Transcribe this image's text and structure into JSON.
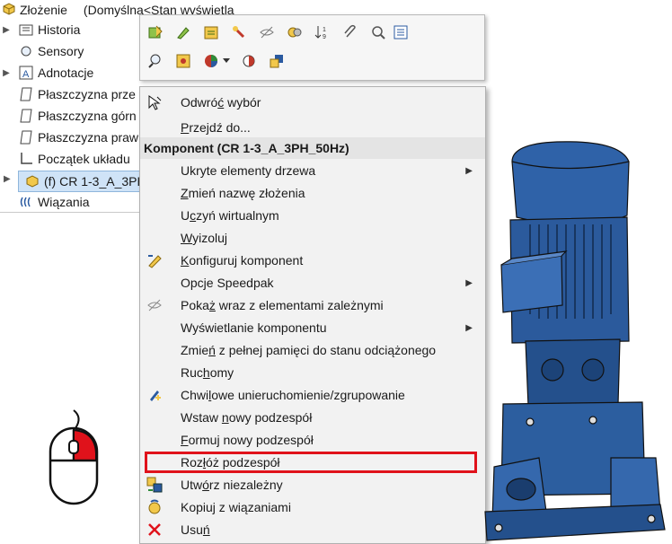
{
  "tree": {
    "title": "Złożenie",
    "config": "(Domyślna<Stan wyświetla",
    "items": [
      {
        "label": "Historia",
        "icon": "folder-icon",
        "expand": true
      },
      {
        "label": "Sensory",
        "icon": "sensor-icon",
        "expand": false
      },
      {
        "label": "Adnotacje",
        "icon": "annotation-icon",
        "expand": true
      },
      {
        "label": "Płaszczyzna prze",
        "icon": "plane-icon",
        "expand": false
      },
      {
        "label": "Płaszczyzna górn",
        "icon": "plane-icon",
        "expand": false
      },
      {
        "label": "Płaszczyzna praw",
        "icon": "plane-icon",
        "expand": false
      },
      {
        "label": "Początek układu",
        "icon": "origin-icon",
        "expand": false
      },
      {
        "label": "(f) CR 1-3_A_3PH",
        "icon": "subassembly-icon",
        "expand": true,
        "selected": true
      },
      {
        "label": "Wiązania",
        "icon": "mates-icon",
        "expand": false
      }
    ]
  },
  "menu": {
    "items": [
      {
        "pre": "Odwró",
        "u": "ć",
        "post": " wybór",
        "icon": "cursor-select-icon"
      },
      {
        "pre": "",
        "u": "P",
        "post": "rzejdź do...",
        "icon": ""
      },
      {
        "header": "Komponent (CR 1-3_A_3PH_50Hz)"
      },
      {
        "pre": "Ukryte elementy drzewa",
        "u": "",
        "post": "",
        "submenu": true
      },
      {
        "pre": "",
        "u": "Z",
        "post": "mień nazwę złożenia"
      },
      {
        "pre": "U",
        "u": "c",
        "post": "zyń wirtualnym"
      },
      {
        "pre": "",
        "u": "W",
        "post": "yizoluj"
      },
      {
        "pre": "",
        "u": "K",
        "post": "onfiguruj komponent",
        "icon": "configure-component-icon"
      },
      {
        "pre": "Opcje Speedpak",
        "u": "",
        "post": "",
        "submenu": true
      },
      {
        "pre": "Poka",
        "u": "ż",
        "post": " wraz z elementami zależnymi",
        "icon": "show-with-dependents-icon"
      },
      {
        "pre": "Wyświetlanie komponentu",
        "u": "",
        "post": "",
        "submenu": true
      },
      {
        "pre": "Zmie",
        "u": "ń",
        "post": " z pełnej pamięci do stanu odciążonego"
      },
      {
        "pre": "Ruc",
        "u": "h",
        "post": "omy"
      },
      {
        "pre": "Chwi",
        "u": "l",
        "post": "owe unieruchomienie/zgrupowanie",
        "icon": "float-group-icon"
      },
      {
        "pre": "Wstaw ",
        "u": "n",
        "post": "owy podzespół"
      },
      {
        "pre": "",
        "u": "F",
        "post": "ormuj nowy podzespół"
      },
      {
        "pre": "Roz",
        "u": "ł",
        "post": "óż podzespół",
        "highlight": true
      },
      {
        "pre": "Utw",
        "u": "ó",
        "post": "rz niezależny",
        "icon": "make-independent-icon"
      },
      {
        "pre": "Kopiuj z wiązaniami",
        "u": "",
        "post": "",
        "icon": "copy-with-mates-icon"
      },
      {
        "pre": "Usu",
        "u": "ń",
        "post": "",
        "icon": "delete-x-icon"
      }
    ]
  },
  "colors": {
    "accent_red": "#e0121b",
    "model_blue": "#2f62a8",
    "selection": "#cfe3f7"
  }
}
